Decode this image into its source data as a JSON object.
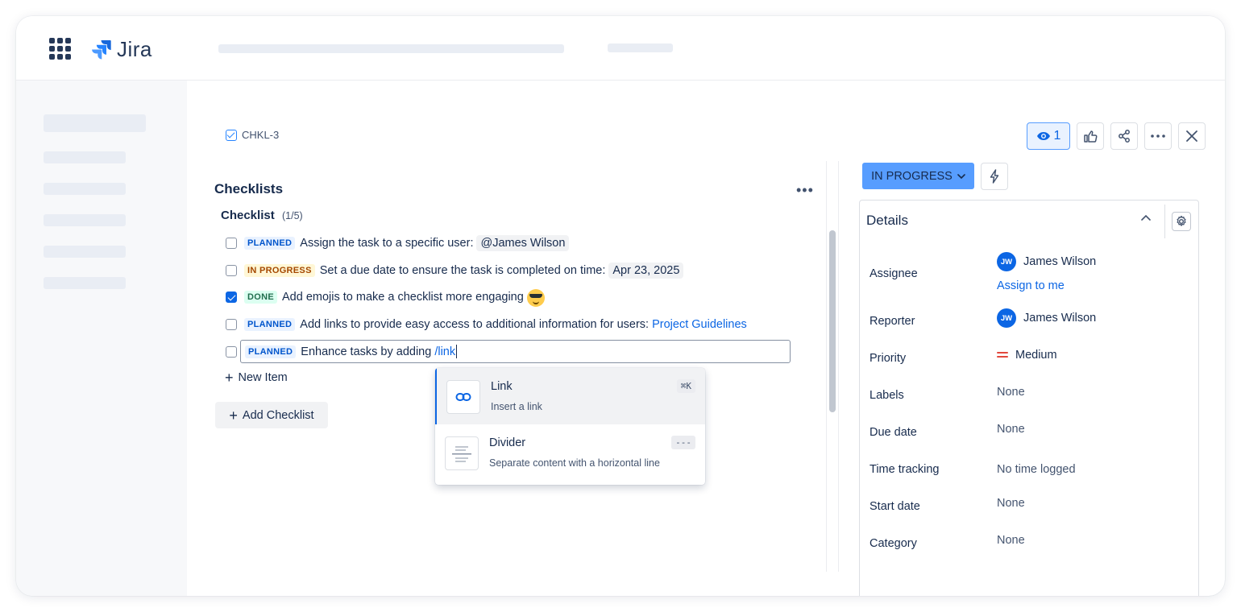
{
  "app": {
    "name": "Jira"
  },
  "issue": {
    "key": "CHKL-3"
  },
  "checklists": {
    "section_title": "Checklists",
    "more_label": "•••",
    "checklist_title": "Checklist",
    "checklist_count": "(1/5)",
    "items": [
      {
        "status": "PLANNED",
        "text": "Assign the task to a specific user:",
        "extra": "@James Wilson",
        "checked": false
      },
      {
        "status": "IN PROGRESS",
        "text": "Set a due date to ensure the task is completed on time:",
        "extra": "Apr 23, 2025",
        "checked": false
      },
      {
        "status": "DONE",
        "text": "Add emojis to make a checklist more engaging",
        "emoji": "smiling-face-with-sunglasses",
        "checked": true
      },
      {
        "status": "PLANNED",
        "text": "Add links to provide easy access to additional information for users:",
        "link": "Project Guidelines",
        "checked": false
      }
    ],
    "editing_item": {
      "status": "PLANNED",
      "text": "Enhance tasks by adding",
      "slash_command": "/link"
    },
    "new_item_label": "New Item",
    "add_checklist_label": "Add Checklist"
  },
  "slash_menu": {
    "items": [
      {
        "title": "Link",
        "description": "Insert a link",
        "shortcut": "⌘K",
        "icon": "link-icon"
      },
      {
        "title": "Divider",
        "description": "Separate content with a horizontal line",
        "shortcut": "---",
        "icon": "divider-icon"
      }
    ]
  },
  "actions": {
    "watch_count": "1"
  },
  "status": {
    "label": "IN PROGRESS"
  },
  "details": {
    "title": "Details",
    "assignee": {
      "label": "Assignee",
      "initials": "JW",
      "name": "James Wilson",
      "assign_me": "Assign to me"
    },
    "reporter": {
      "label": "Reporter",
      "initials": "JW",
      "name": "James Wilson"
    },
    "priority": {
      "label": "Priority",
      "value": "Medium"
    },
    "labels": {
      "label": "Labels",
      "value": "None"
    },
    "due_date": {
      "label": "Due date",
      "value": "None"
    },
    "time_tracking": {
      "label": "Time tracking",
      "value": "No time logged"
    },
    "start_date": {
      "label": "Start date",
      "value": "None"
    },
    "category": {
      "label": "Category",
      "value": "None"
    }
  },
  "colors": {
    "accent": "#0c66e4",
    "status_button": "#579dff",
    "planned": "#0055cc",
    "in_progress": "#a54800",
    "done": "#216e4e"
  }
}
